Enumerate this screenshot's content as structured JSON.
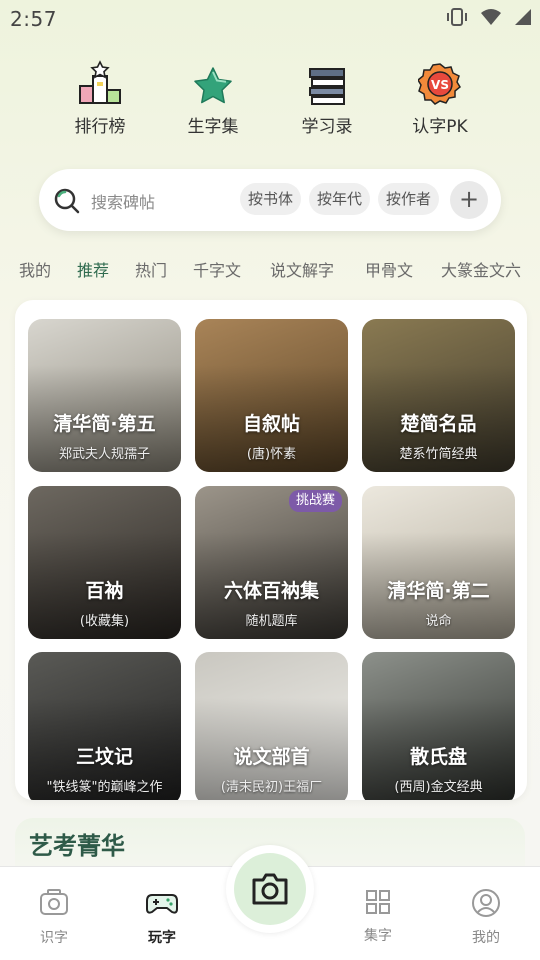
{
  "status": {
    "time": "2:57"
  },
  "quicknav": [
    {
      "label": "排行榜",
      "icon": "podium-icon"
    },
    {
      "label": "生字集",
      "icon": "star-icon"
    },
    {
      "label": "学习录",
      "icon": "books-icon"
    },
    {
      "label": "认字PK",
      "icon": "vs-badge-icon",
      "icon_text": "VS"
    }
  ],
  "search": {
    "placeholder": "搜索碑帖",
    "chips": [
      "按书体",
      "按年代",
      "按作者"
    ],
    "plus": "+"
  },
  "tabs": [
    "我的",
    "推荐",
    "热门",
    "千字文",
    "说文解字",
    "甲骨文",
    "大篆金文六"
  ],
  "active_tab": "推荐",
  "tiles": [
    {
      "title": "清华简·第五",
      "subtitle": "郑武夫人规孺子",
      "colors": [
        "#8a8578",
        "#d8d6cf"
      ]
    },
    {
      "title": "自叙帖",
      "subtitle": "(唐)怀素",
      "colors": [
        "#5a4426",
        "#a98458"
      ]
    },
    {
      "title": "楚简名品",
      "subtitle": "楚系竹简经典",
      "colors": [
        "#3f3a2c",
        "#8a7a52"
      ]
    },
    {
      "title": "百衲",
      "subtitle": "(收藏集)",
      "colors": [
        "#2a2622",
        "#6d6860"
      ]
    },
    {
      "title": "六体百衲集",
      "subtitle": "随机题库",
      "badge": "挑战赛",
      "colors": [
        "#3b3833",
        "#9c958a"
      ]
    },
    {
      "title": "清华简·第二",
      "subtitle": "说命",
      "colors": [
        "#b1aa9a",
        "#ece8de"
      ]
    },
    {
      "title": "三坟记",
      "subtitle": "\"铁线篆\"的巅峰之作",
      "colors": [
        "#1f1f1f",
        "#5a5a56"
      ]
    },
    {
      "title": "说文部首",
      "subtitle": "(清末民初)王福厂",
      "colors": [
        "#f3f2ee",
        "#c9c7c0"
      ]
    },
    {
      "title": "散氏盘",
      "subtitle": "(西周)金文经典",
      "colors": [
        "#2b2e2a",
        "#8d918b"
      ]
    }
  ],
  "section": {
    "title": "艺考菁华"
  },
  "bottomnav": [
    {
      "label": "识字",
      "icon": "camera-scan-icon"
    },
    {
      "label": "玩字",
      "icon": "gamepad-icon",
      "active": true
    },
    {
      "label": "集字",
      "icon": "grid-icon"
    },
    {
      "label": "我的",
      "icon": "profile-icon"
    }
  ],
  "colors": {
    "accent": "#2f6b4f",
    "badge": "#7d5aa8",
    "camera_bg": "#dcefd9"
  }
}
